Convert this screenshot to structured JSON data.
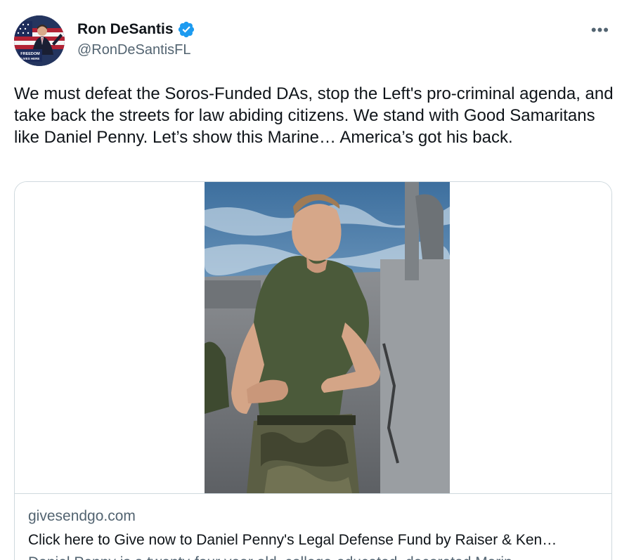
{
  "tweet": {
    "author": {
      "display_name": "Ron DeSantis",
      "handle": "@RonDeSantisFL",
      "avatar_text": "FREEDOM LIVES HERE"
    },
    "more_icon": "more-horizontal-icon",
    "text": "We must defeat the Soros-Funded DAs, stop the Left's pro-criminal agenda, and take back the streets for law abiding citizens. We stand with Good Samaritans like Daniel Penny. Let’s show this Marine… America’s got his back.",
    "card": {
      "domain": "givesendgo.com",
      "title": "Click here to Give now to Daniel Penny's Legal Defense Fund by Raiser & Ken…",
      "description": "Daniel Penny is a twenty-four year old, college-educated, decorated Marin…"
    }
  },
  "colors": {
    "text_primary": "#0f1419",
    "text_secondary": "#536471",
    "verified_blue": "#1d9bf0",
    "border": "#cfd9de"
  }
}
